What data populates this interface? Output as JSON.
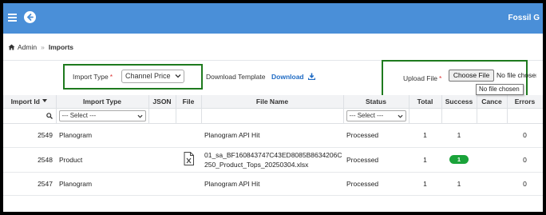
{
  "header": {
    "brand": "Fossil G"
  },
  "breadcrumb": {
    "root": "Admin",
    "separator": "»",
    "current": "Imports"
  },
  "filters": {
    "import_type_label": "Import Type",
    "required_mark": "*",
    "import_type_value": "Channel Price",
    "download_template_label": "Download Template",
    "download_link": "Download",
    "upload_label": "Upload File",
    "choose_file_button": "Choose File",
    "no_file_text": "No file chosen",
    "tooltip": "No file chosen"
  },
  "table": {
    "headers": {
      "import_id": "Import Id",
      "import_type": "Import Type",
      "json": "JSON",
      "file": "File",
      "file_name": "File Name",
      "status": "Status",
      "total": "Total",
      "success": "Success",
      "cancel": "Cance",
      "errors": "Errors"
    },
    "filter_select": "--- Select ---",
    "rows": [
      {
        "id": "2549",
        "type": "Planogram",
        "has_file_icon": false,
        "file_name_1": "Planogram API Hit",
        "file_name_2": "",
        "status": "Processed",
        "total": "1",
        "success": "1",
        "success_badge": false,
        "errors": "0"
      },
      {
        "id": "2548",
        "type": "Product",
        "has_file_icon": true,
        "file_name_1": "01_sa_BF160843747C43ED8085B8634206C",
        "file_name_2": "250_Product_Tops_20250304.xlsx",
        "status": "Processed",
        "total": "1",
        "success": "1",
        "success_badge": true,
        "errors": "0"
      },
      {
        "id": "2547",
        "type": "Planogram",
        "has_file_icon": false,
        "file_name_1": "Planogram API Hit",
        "file_name_2": "",
        "status": "Processed",
        "total": "1",
        "success": "1",
        "success_badge": false,
        "errors": "0"
      }
    ]
  },
  "colors": {
    "topbar": "#4a8fd8",
    "highlight_box": "#1e7a1e",
    "link": "#1f6bc4",
    "success_badge": "#1aa33a"
  }
}
